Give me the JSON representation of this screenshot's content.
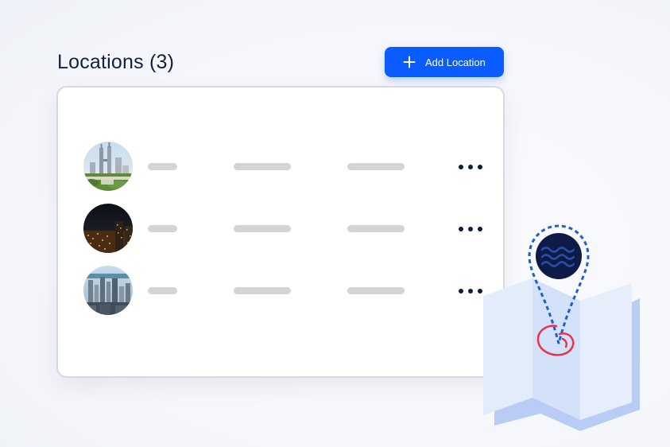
{
  "header": {
    "title": "Locations (3)",
    "add_button_label": "Add Location"
  },
  "locations": [
    {
      "avatar": "city-skyline-twin-towers-photo"
    },
    {
      "avatar": "city-night-lights-photo"
    },
    {
      "avatar": "city-harbor-skyline-photo"
    }
  ],
  "colors": {
    "accent": "#0b5cff",
    "title_text": "#14213d",
    "placeholder_bar": "#d2d4d8",
    "pin_dark": "#0d1b48",
    "pin_dash": "#1e5fd0",
    "target_red": "#e8344f",
    "map_light": "#dde8fb",
    "map_mid": "#b9cdf4"
  },
  "icons": {
    "add": "plus-icon",
    "more": "more-horizontal-icon",
    "pin": "map-pin-icon",
    "map": "folded-map-icon"
  }
}
